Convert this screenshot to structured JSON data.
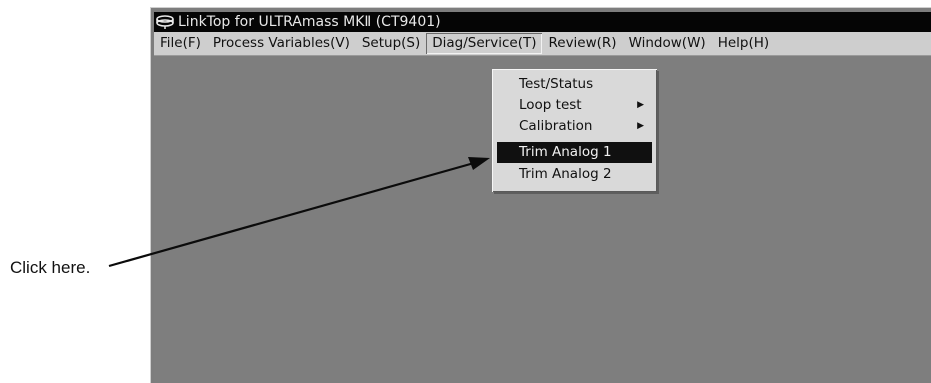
{
  "window": {
    "title": "LinkTop for ULTRAmass MKⅡ (CT9401)",
    "icon": "linktop-app-icon"
  },
  "menubar": {
    "items": [
      {
        "label": "File(F)",
        "underline_char": "F"
      },
      {
        "label": "Process Variables(V)",
        "underline_char": "V"
      },
      {
        "label": "Setup(S)",
        "underline_char": "S"
      },
      {
        "label": "Diag/Service(T)",
        "underline_char": "T",
        "open": true
      },
      {
        "label": "Review(R)",
        "underline_char": "R"
      },
      {
        "label": "Window(W)",
        "underline_char": "W"
      },
      {
        "label": "Help(H)",
        "underline_char": "H"
      }
    ]
  },
  "dropdown": {
    "items": [
      {
        "label": "Test/Status",
        "submenu": false
      },
      {
        "label": "Loop test",
        "submenu": true
      },
      {
        "label": "Calibration",
        "submenu": true
      },
      {
        "label": "Trim Analog 1",
        "submenu": false,
        "selected": true
      },
      {
        "label": "Trim Analog 2",
        "submenu": false
      }
    ]
  },
  "annotation": {
    "callout_text": "Click here."
  },
  "colors": {
    "titlebar": "#050505",
    "menubar": "#cecece",
    "client_area": "#7e7e7e",
    "selection": "#101010"
  }
}
